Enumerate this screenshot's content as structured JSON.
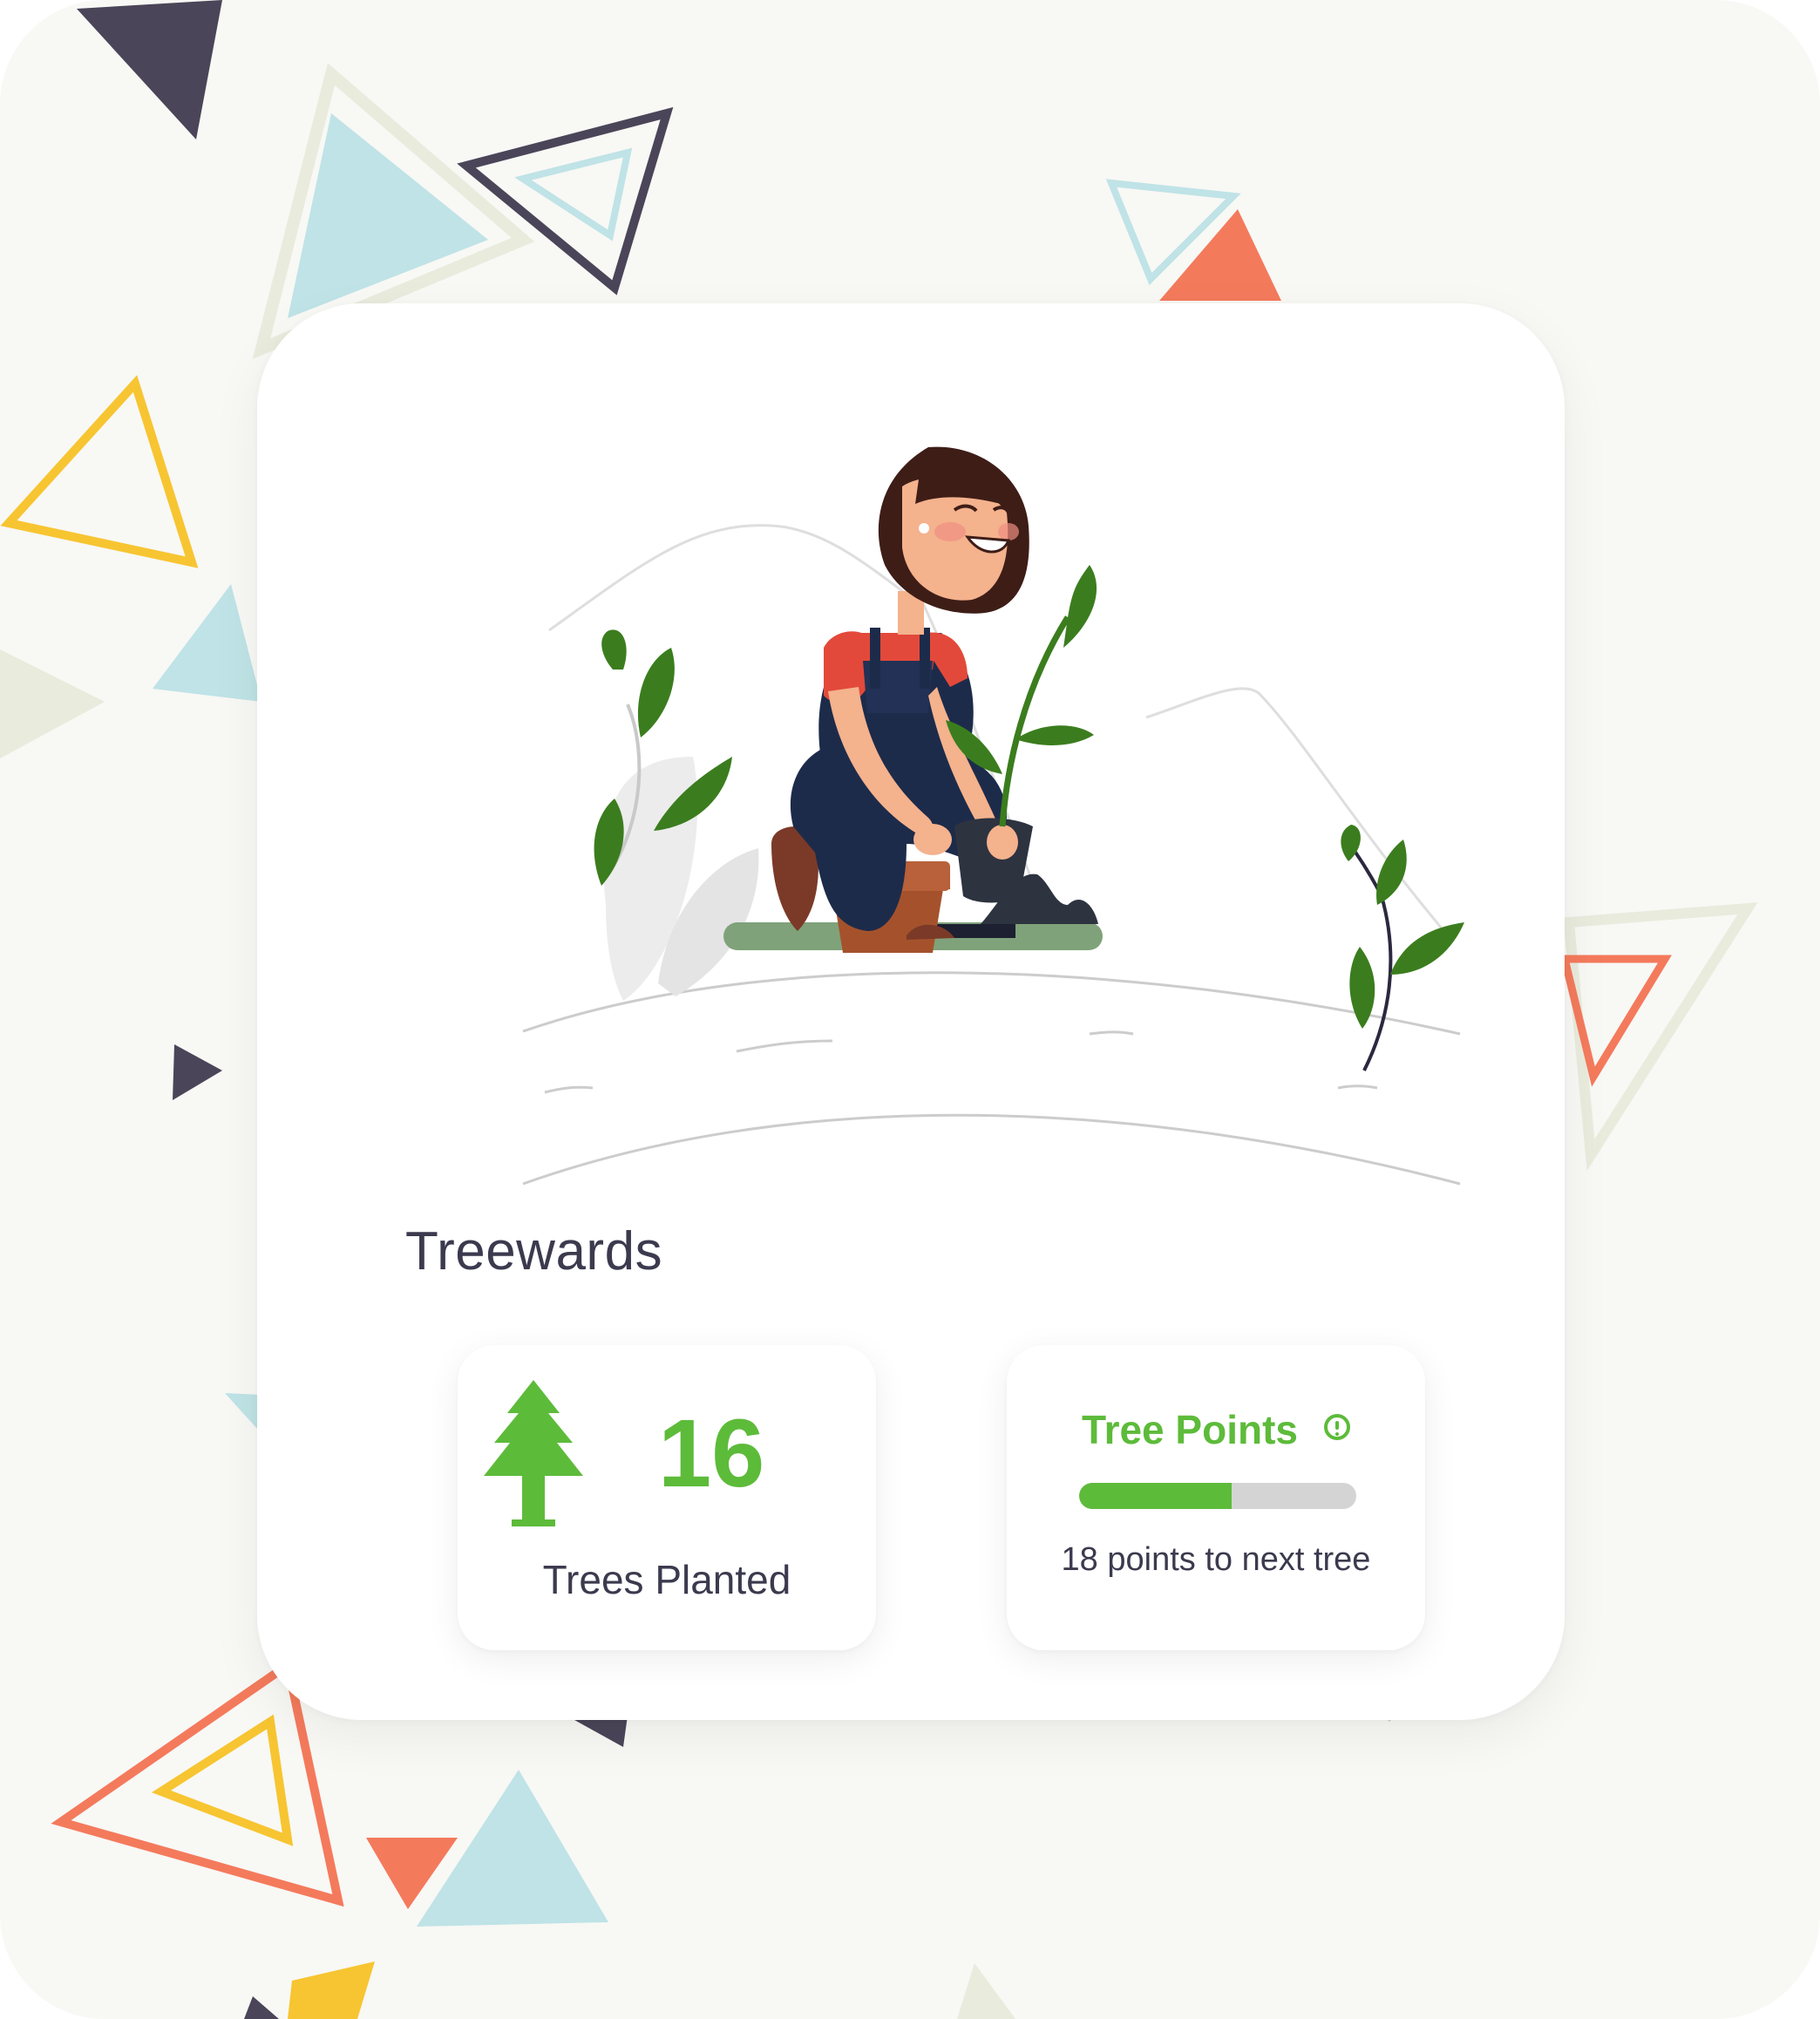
{
  "app": {
    "title": "Treewards"
  },
  "trees_planted": {
    "count": "16",
    "label": "Trees Planted",
    "icon": "pine-tree-icon"
  },
  "tree_points": {
    "title": "Tree Points",
    "progress": 0.55,
    "caption": "18 points to next tree",
    "info_icon": "info-icon"
  },
  "colors": {
    "accent_green": "#5dbb3a",
    "text_dark": "#3b3a4e",
    "track_gray": "#d4d4d4",
    "background": "#f8f8f5",
    "confetti": [
      "#4a4558",
      "#bfe3e6",
      "#f47a5c",
      "#f7c531",
      "#e9ebdd"
    ]
  },
  "illustration": {
    "subject": "woman-planting-seedling"
  }
}
